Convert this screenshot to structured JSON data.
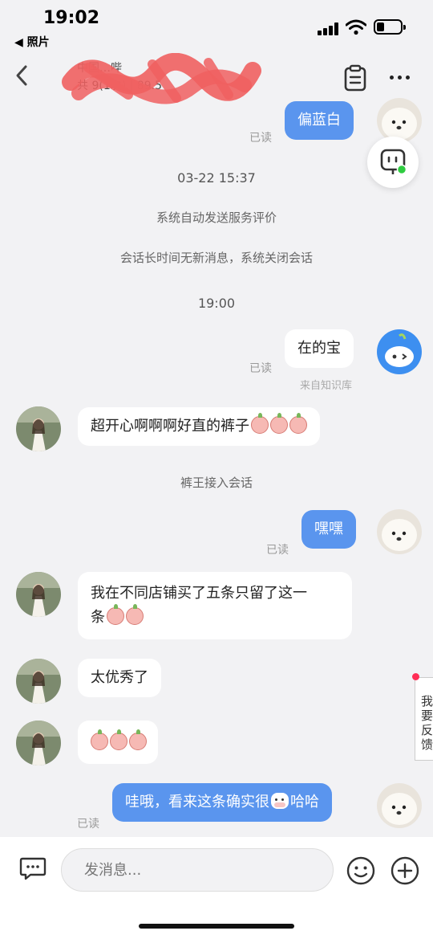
{
  "status_bar": {
    "time": "19:02",
    "back_app": "◀ 照片"
  },
  "nav": {
    "shop_title": "中国…哔",
    "shop_sub": "共 9(1次) | 89.5"
  },
  "messages": {
    "m1": {
      "text": "偏蓝白",
      "read": "已读"
    },
    "ts1": "03-22 15:37",
    "sys1": "系统自动发送服务评价",
    "sys2": "会话长时间无新消息，系统关闭会话",
    "ts2": "19:00",
    "m2": {
      "text": "在的宝",
      "read": "已读",
      "source": "来自知识库"
    },
    "m3": {
      "text": "超开心啊啊啊好直的裤子"
    },
    "sys3": "裤王接入会话",
    "m4": {
      "text": "嘿嘿",
      "read": "已读"
    },
    "m5": {
      "line1": "我在不同店铺买了五条只留了这一",
      "line2": "条"
    },
    "m6": {
      "text": "太优秀了"
    },
    "m8": {
      "text_a": "哇哦，看来这条确实很",
      "text_b": "哈哈",
      "read": "已读"
    }
  },
  "feedback": "我要反馈",
  "input": {
    "placeholder": "发消息..."
  },
  "colors": {
    "outgoing_bubble": "#5a95ee",
    "incoming_bubble": "#ffffff",
    "background": "#f2f2f4",
    "online_dot": "#2ecc40",
    "feedback_dot": "#ff2d55"
  }
}
